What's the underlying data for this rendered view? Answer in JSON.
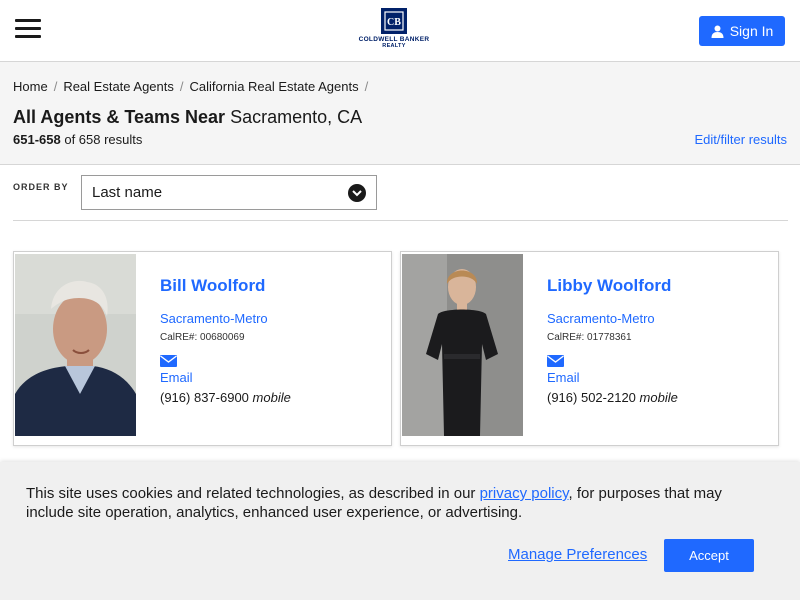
{
  "header": {
    "logo_line1": "COLDWELL BANKER",
    "logo_line2": "REALTY",
    "signin_label": "Sign In",
    "brand_color": "#012169",
    "accent_color": "#1f69ff"
  },
  "breadcrumb": [
    "Home",
    "Real Estate Agents",
    "California Real Estate Agents"
  ],
  "title": {
    "bold": "All Agents & Teams Near",
    "location": "Sacramento, CA"
  },
  "results": {
    "range": "651-658",
    "suffix": "of 658 results",
    "edit_filter": "Edit/filter results"
  },
  "order": {
    "label": "ORDER BY",
    "selected": "Last name"
  },
  "agents": [
    {
      "name": "Bill Woolford",
      "region": "Sacramento-Metro",
      "calre": "CalRE#: 00680069",
      "email": "Email",
      "phone": "(916) 837-6900",
      "phone_type": "mobile"
    },
    {
      "name": "Libby Woolford",
      "region": "Sacramento-Metro",
      "calre": "CalRE#: 01778361",
      "email": "Email",
      "phone": "(916) 502-2120",
      "phone_type": "mobile"
    }
  ],
  "cookie": {
    "text_before": "This site uses cookies and related technologies, as described in our ",
    "link": "privacy policy",
    "text_after": ", for purposes that may include site operation, analytics, enhanced user experience, or advertising.",
    "manage": "Manage Preferences",
    "accept": "Accept"
  }
}
